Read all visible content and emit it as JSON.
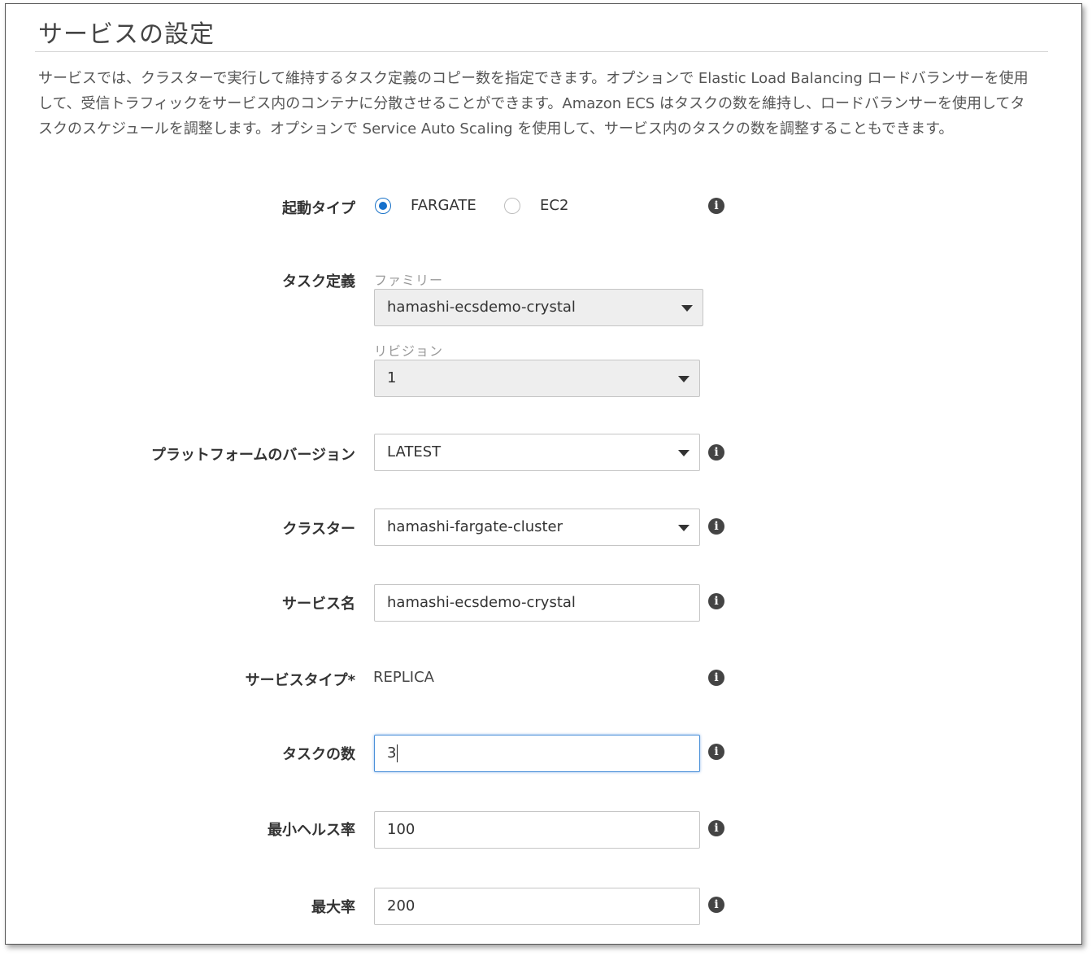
{
  "section": {
    "title": "サービスの設定",
    "description": "サービスでは、クラスターで実行して維持するタスク定義のコピー数を指定できます。オプションで Elastic Load Balancing ロードバランサーを使用して、受信トラフィックをサービス内のコンテナに分散させることができます。Amazon ECS はタスクの数を維持し、ロードバランサーを使用してタスクのスケジュールを調整します。オプションで Service Auto Scaling を使用して、サービス内のタスクの数を調整することもできます。"
  },
  "launch_type": {
    "label": "起動タイプ",
    "options": [
      "FARGATE",
      "EC2"
    ],
    "selected": "FARGATE"
  },
  "task_definition": {
    "label": "タスク定義",
    "family_label": "ファミリー",
    "family_value": "hamashi-ecsdemo-crystal",
    "revision_label": "リビジョン",
    "revision_value": "1"
  },
  "platform_version": {
    "label": "プラットフォームのバージョン",
    "value": "LATEST"
  },
  "cluster": {
    "label": "クラスター",
    "value": "hamashi-fargate-cluster"
  },
  "service_name": {
    "label": "サービス名",
    "value": "hamashi-ecsdemo-crystal"
  },
  "service_type": {
    "label": "サービスタイプ*",
    "value": "REPLICA"
  },
  "task_count": {
    "label": "タスクの数",
    "value": "3"
  },
  "min_healthy": {
    "label": "最小ヘルス率",
    "value": "100"
  },
  "max_percent": {
    "label": "最大率",
    "value": "200"
  },
  "icons": {
    "info": "info-icon",
    "caret": "chevron-down-icon"
  },
  "info_glyph": "i",
  "colors": {
    "accent": "#1570cc",
    "focus": "#4a90d9"
  }
}
